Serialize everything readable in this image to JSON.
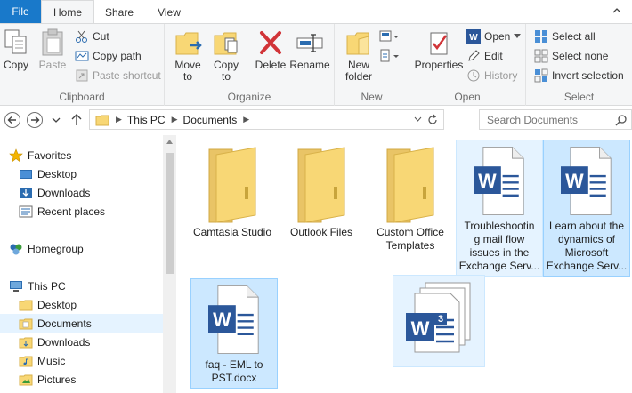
{
  "ribbon_tabs": {
    "file": "File",
    "home": "Home",
    "share": "Share",
    "view": "View"
  },
  "clipboard": {
    "copy": "Copy",
    "paste": "Paste",
    "cut": "Cut",
    "copy_path": "Copy path",
    "paste_shortcut": "Paste shortcut",
    "label": "Clipboard"
  },
  "organize": {
    "move_to_1": "Move",
    "move_to_2": "to",
    "copy_to_1": "Copy",
    "copy_to_2": "to",
    "delete": "Delete",
    "rename": "Rename",
    "label": "Organize"
  },
  "new": {
    "new_folder_1": "New",
    "new_folder_2": "folder",
    "label": "New"
  },
  "open": {
    "properties": "Properties",
    "open": "Open",
    "edit": "Edit",
    "history": "History",
    "label": "Open"
  },
  "select": {
    "select_all": "Select all",
    "select_none": "Select none",
    "invert_selection": "Invert selection",
    "label": "Select"
  },
  "address": {
    "this_pc": "This PC",
    "documents": "Documents"
  },
  "search": {
    "placeholder": "Search Documents"
  },
  "nav_pane": {
    "favorites": "Favorites",
    "desktop": "Desktop",
    "downloads": "Downloads",
    "recent_places": "Recent places",
    "homegroup": "Homegroup",
    "this_pc": "This PC",
    "pc_desktop": "Desktop",
    "pc_documents": "Documents",
    "pc_downloads": "Downloads",
    "pc_music": "Music",
    "pc_pictures": "Pictures"
  },
  "files": {
    "camtasia": "Camtasia Studio",
    "outlook": "Outlook Files",
    "custom_office_1": "Custom Office",
    "custom_office_2": "Templates",
    "troubleshoot_1": "Troubleshootin",
    "troubleshoot_2": "g mail flow",
    "troubleshoot_3": "issues in the",
    "troubleshoot_4": "Exchange Serv...",
    "learn_1": "Learn about the",
    "learn_2": "dynamics of",
    "learn_3": "Microsoft",
    "learn_4": "Exchange Serv...",
    "faq_1": "faq - EML to",
    "faq_2": "PST.docx"
  },
  "drag_badge": "3",
  "colors": {
    "accent": "#1979ca",
    "selection": "#cce8ff",
    "word_blue": "#2b579a",
    "folder": "#f8d775"
  }
}
